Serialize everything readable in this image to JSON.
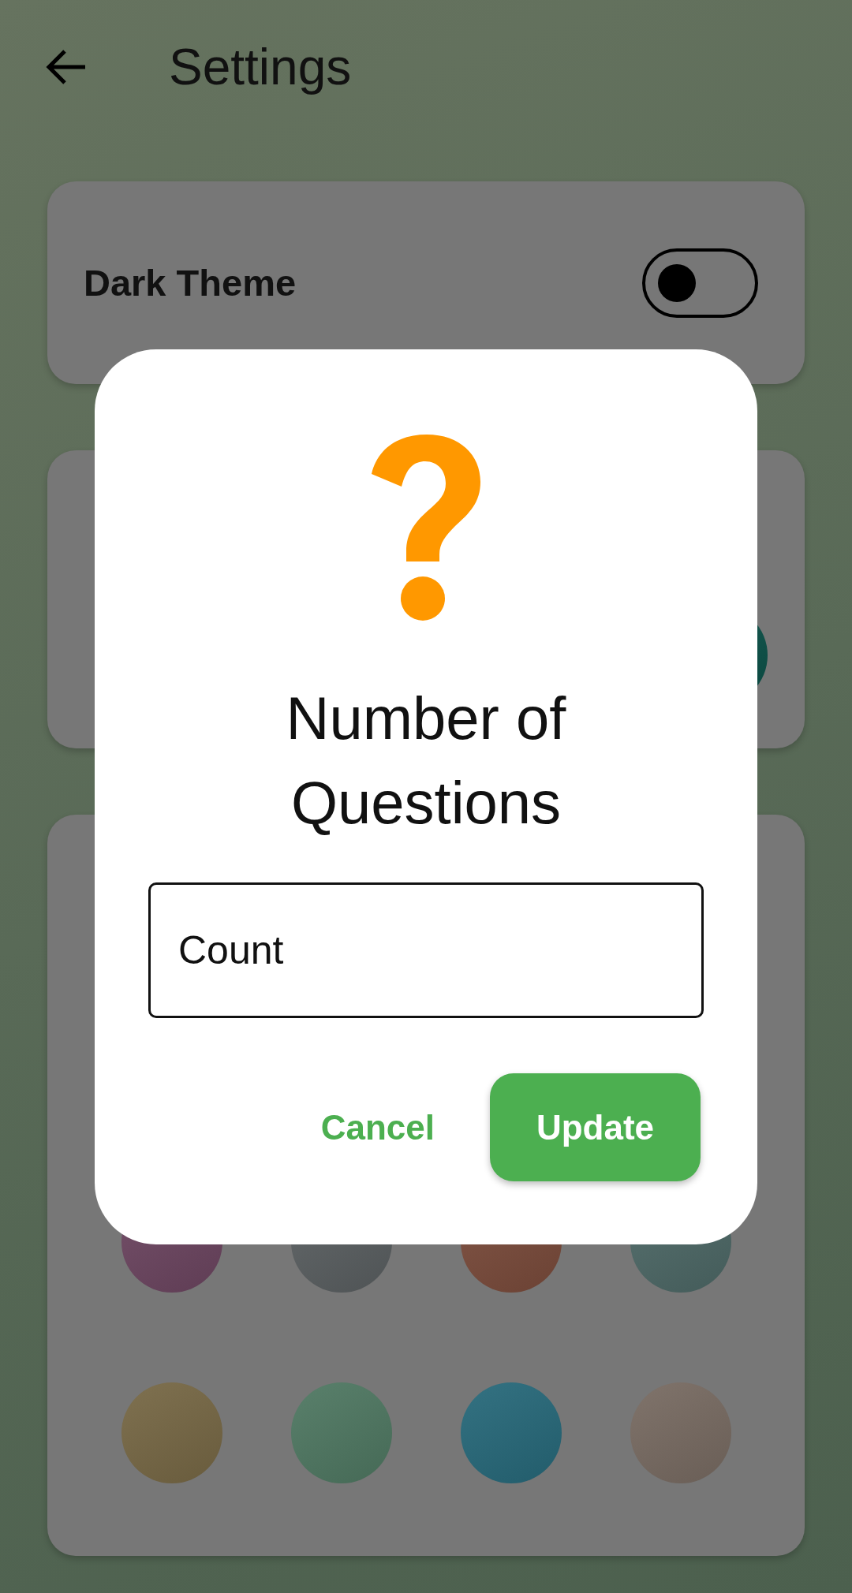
{
  "app_bar": {
    "title": "Settings"
  },
  "settings": [
    {
      "kind": "toggle",
      "label": "Dark Theme",
      "on": false
    },
    {
      "kind": "swatches",
      "swatches": [
        {
          "color": "#0b5148"
        }
      ]
    },
    {
      "kind": "palette",
      "rows": [
        [
          {
            "color": "#6c4560"
          },
          {
            "color": "#5a5f61"
          },
          {
            "color": "#7a4b3b"
          },
          {
            "color": "#4d6866"
          }
        ],
        [
          {
            "color": "#776845"
          },
          {
            "color": "#4f7862"
          },
          {
            "color": "#27697a"
          },
          {
            "color": "#786b62"
          }
        ]
      ]
    }
  ],
  "dialog": {
    "title": "Number of Questions",
    "field": {
      "placeholder": "Count"
    },
    "buttons": [
      {
        "label": "Cancel",
        "kind": "text"
      },
      {
        "label": "Update",
        "kind": "filled"
      }
    ]
  }
}
